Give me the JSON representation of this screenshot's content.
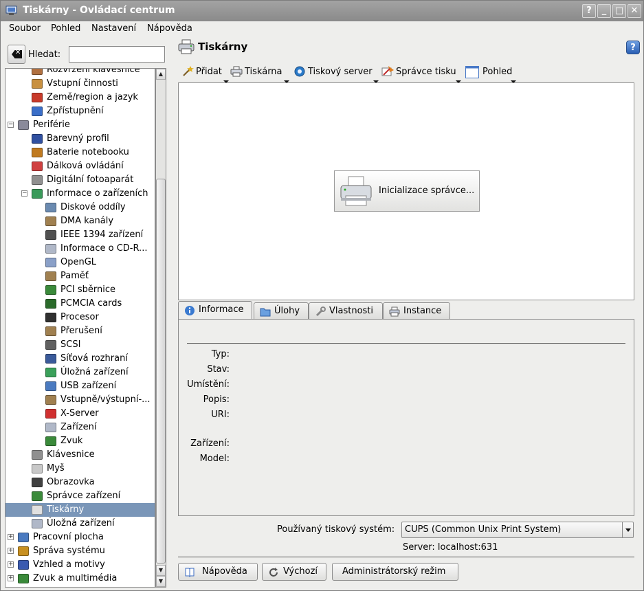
{
  "window": {
    "title": "Tiskárny - Ovládací centrum",
    "buttons": [
      "?",
      "_",
      "□",
      "✕"
    ]
  },
  "menubar": [
    "Soubor",
    "Pohled",
    "Nastavení",
    "Nápověda"
  ],
  "search": {
    "label": "Hledat:",
    "value": ""
  },
  "tree": [
    {
      "label": "Rozvržení klávesnice",
      "level": 1,
      "icon": "keyboard-layout-icon",
      "color": "#b07040"
    },
    {
      "label": "Vstupní činnosti",
      "level": 1,
      "icon": "keyboard-icon",
      "color": "#c89040"
    },
    {
      "label": "Země/region a jazyk",
      "level": 1,
      "icon": "flag-icon",
      "color": "#c83a2a"
    },
    {
      "label": "Zpřístupnění",
      "level": 1,
      "icon": "accessibility-icon",
      "color": "#3a6ec8"
    },
    {
      "label": "Periférie",
      "level": 0,
      "icon": "mouse-icon",
      "color": "#8a8a9a",
      "expander": "−"
    },
    {
      "label": "Barevný profil",
      "level": 1,
      "icon": "color-profile-icon",
      "color": "#3050a0"
    },
    {
      "label": "Baterie notebooku",
      "level": 1,
      "icon": "battery-icon",
      "color": "#c07a20"
    },
    {
      "label": "Dálková ovládání",
      "level": 1,
      "icon": "remote-control-icon",
      "color": "#d04040"
    },
    {
      "label": "Digitální fotoaparát",
      "level": 1,
      "icon": "camera-icon",
      "color": "#909090"
    },
    {
      "label": "Informace o zařízeních",
      "level": 1,
      "icon": "device-info-icon",
      "color": "#3a9a5a",
      "expander": "−"
    },
    {
      "label": "Diskové oddíly",
      "level": 2,
      "icon": "disk-partitions-icon",
      "color": "#6a8ab0"
    },
    {
      "label": "DMA kanály",
      "level": 2,
      "icon": "dma-icon",
      "color": "#a08050"
    },
    {
      "label": "IEEE 1394 zařízení",
      "level": 2,
      "icon": "firewire-icon",
      "color": "#505050"
    },
    {
      "label": "Informace o CD-R...",
      "level": 2,
      "icon": "cdrom-icon",
      "color": "#b0b8c8"
    },
    {
      "label": "OpenGL",
      "level": 2,
      "icon": "opengl-icon",
      "color": "#8aa0c8"
    },
    {
      "label": "Paměť",
      "level": 2,
      "icon": "memory-icon",
      "color": "#a08050"
    },
    {
      "label": "PCI sběrnice",
      "level": 2,
      "icon": "pci-icon",
      "color": "#3a8a3a"
    },
    {
      "label": "PCMCIA cards",
      "level": 2,
      "icon": "pcmcia-icon",
      "color": "#2a6a2a"
    },
    {
      "label": "Procesor",
      "level": 2,
      "icon": "cpu-icon",
      "color": "#303030"
    },
    {
      "label": "Přerušení",
      "level": 2,
      "icon": "interrupt-icon",
      "color": "#a08050"
    },
    {
      "label": "SCSI",
      "level": 2,
      "icon": "scsi-icon",
      "color": "#606060"
    },
    {
      "label": "Síťová rozhraní",
      "level": 2,
      "icon": "network-icon",
      "color": "#3a5a9a"
    },
    {
      "label": "Úložná zařízení",
      "level": 2,
      "icon": "storage-icon",
      "color": "#3aa05a"
    },
    {
      "label": "USB zařízení",
      "level": 2,
      "icon": "usb-icon",
      "color": "#4a7ac0"
    },
    {
      "label": "Vstupně/výstupní-...",
      "level": 2,
      "icon": "io-ports-icon",
      "color": "#a08050"
    },
    {
      "label": "X-Server",
      "level": 2,
      "icon": "x-server-icon",
      "color": "#d03030"
    },
    {
      "label": "Zařízení",
      "level": 2,
      "icon": "devices-icon",
      "color": "#b0b8c8"
    },
    {
      "label": "Zvuk",
      "level": 2,
      "icon": "sound-icon",
      "color": "#3a8a3a"
    },
    {
      "label": "Klávesnice",
      "level": 1,
      "icon": "keyboard-icon",
      "color": "#909090"
    },
    {
      "label": "Myš",
      "level": 1,
      "icon": "mouse-icon",
      "color": "#c8c8c8"
    },
    {
      "label": "Obrazovka",
      "level": 1,
      "icon": "display-icon",
      "color": "#404040"
    },
    {
      "label": "Správce zařízení",
      "level": 1,
      "icon": "device-manager-icon",
      "color": "#3a8a3a"
    },
    {
      "label": "Tiskárny",
      "level": 1,
      "icon": "printer-icon",
      "color": "#e0e0e0",
      "selected": true
    },
    {
      "label": "Úložná zařízení",
      "level": 1,
      "icon": "storage-icon",
      "color": "#b0b8c8"
    },
    {
      "label": "Pracovní plocha",
      "level": 0,
      "icon": "desktop-icon",
      "color": "#4a7ac0",
      "expander": "+"
    },
    {
      "label": "Správa systému",
      "level": 0,
      "icon": "system-admin-icon",
      "color": "#c89020",
      "expander": "+"
    },
    {
      "label": "Vzhled a motivy",
      "level": 0,
      "icon": "appearance-icon",
      "color": "#3a5ab0",
      "expander": "+"
    },
    {
      "label": "Zvuk a multimédia",
      "level": 0,
      "icon": "multimedia-icon",
      "color": "#3a8a3a",
      "expander": "+"
    }
  ],
  "page": {
    "title": "Tiskárny"
  },
  "toolbar": [
    {
      "label": "Přidat",
      "icon": "wand-icon",
      "color": "#e0b020"
    },
    {
      "label": "Tiskárna",
      "icon": "printer-icon",
      "color": "#d0d4dc"
    },
    {
      "label": "Tiskový server",
      "icon": "server-gear-icon",
      "color": "#2a7ac8"
    },
    {
      "label": "Správce tisku",
      "icon": "print-manager-icon",
      "color": "#e08020"
    },
    {
      "label": "Pohled",
      "icon": "view-icon",
      "color": "#4a7ac8"
    }
  ],
  "init_button": "Inicializace správce...",
  "tabs": [
    {
      "label": "Informace",
      "icon": "info-icon",
      "color": "#3a7ad0",
      "active": true
    },
    {
      "label": "Úlohy",
      "icon": "folder-icon",
      "color": "#3a7ad0"
    },
    {
      "label": "Vlastnosti",
      "icon": "wrench-icon",
      "color": "#a0a0a0"
    },
    {
      "label": "Instance",
      "icon": "printer-icon",
      "color": "#c0c8d8"
    }
  ],
  "info_fields": [
    "Typ:",
    "Stav:",
    "Umístění:",
    "Popis:",
    "URI:",
    "",
    "Zařízení:",
    "Model:"
  ],
  "print_system": {
    "label": "Používaný tiskový systém:",
    "value": "CUPS (Common Unix Print System)"
  },
  "server": "Server: localhost:631",
  "buttons": [
    {
      "label": "Nápověda",
      "icon": "help-book-icon",
      "color": "#3a6ac0"
    },
    {
      "label": "Výchozí",
      "icon": "reset-icon",
      "color": "#505050"
    },
    {
      "label": "Administrátorský režim",
      "icon": "",
      "color": ""
    }
  ]
}
